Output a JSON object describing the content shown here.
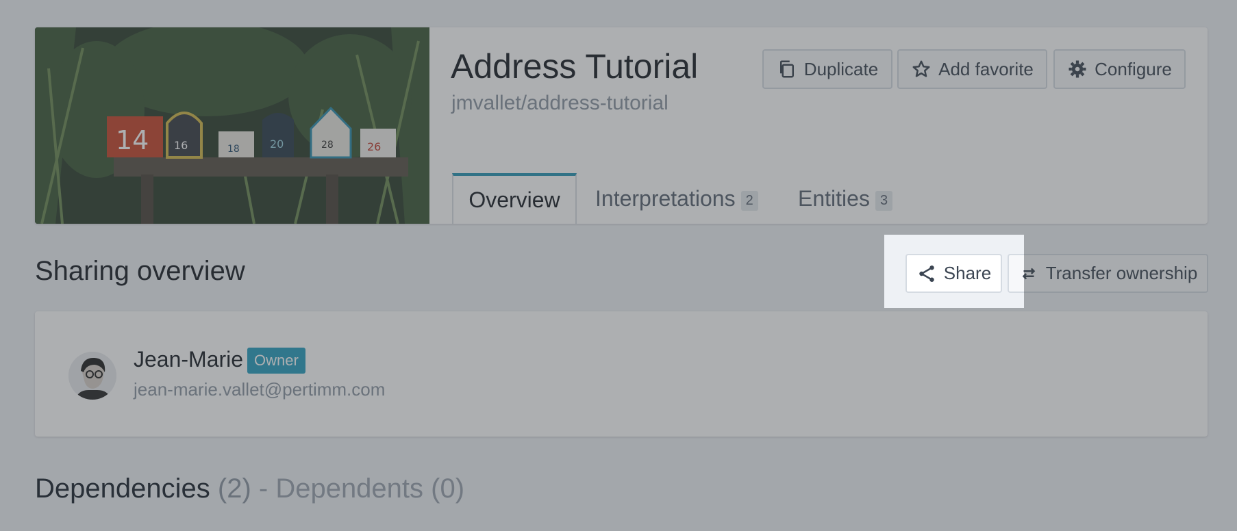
{
  "header": {
    "title": "Address Tutorial",
    "slug": "jmvallet/address-tutorial",
    "actions": {
      "duplicate": "Duplicate",
      "favorite": "Add favorite",
      "configure": "Configure"
    },
    "cover_numbers": [
      "14",
      "16",
      "18",
      "20",
      "28",
      "26"
    ],
    "tabs": [
      {
        "label": "Overview"
      },
      {
        "label": "Interpretations",
        "count": "2"
      },
      {
        "label": "Entities",
        "count": "3"
      }
    ]
  },
  "sharing": {
    "title": "Sharing overview",
    "share_label": "Share",
    "transfer_label": "Transfer ownership",
    "user": {
      "name": "Jean-Marie",
      "role": "Owner",
      "email": "jean-marie.vallet@pertimm.com"
    }
  },
  "dependencies": {
    "label": "Dependencies",
    "count": "(2)",
    "separator": " - ",
    "dependents_label": "Dependents",
    "dependents_count": "(0)"
  },
  "colors": {
    "accent": "#2a97b5",
    "badge": "#2a9fc0"
  }
}
